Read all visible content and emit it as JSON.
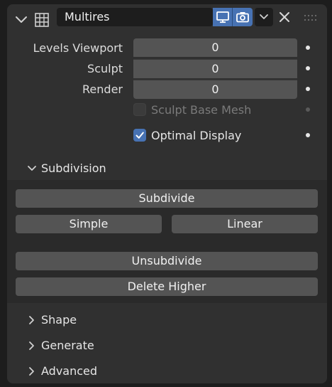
{
  "header": {
    "modifier_name": "Multires",
    "icons": [
      "chevron-down-icon",
      "grid-icon",
      "monitor-icon",
      "camera-icon",
      "chevron-down-icon",
      "close-icon",
      "drag-handle-icon"
    ]
  },
  "properties": {
    "levels_viewport": {
      "label": "Levels Viewport",
      "value": "0"
    },
    "sculpt": {
      "label": "Sculpt",
      "value": "0"
    },
    "render": {
      "label": "Render",
      "value": "0"
    }
  },
  "checks": {
    "sculpt_base_mesh": {
      "label": "Sculpt Base Mesh",
      "checked": false,
      "enabled": false
    },
    "optimal_display": {
      "label": "Optimal Display",
      "checked": true,
      "enabled": true
    }
  },
  "subdivision": {
    "title": "Subdivision",
    "subdivide": "Subdivide",
    "simple": "Simple",
    "linear": "Linear",
    "unsubdivide": "Unsubdivide",
    "delete_higher": "Delete Higher"
  },
  "collapsed": {
    "shape": "Shape",
    "generate": "Generate",
    "advanced": "Advanced"
  },
  "colors": {
    "accent": "#4772b3",
    "panel": "#303030",
    "field": "#545454",
    "background": "#1d1d1d"
  }
}
